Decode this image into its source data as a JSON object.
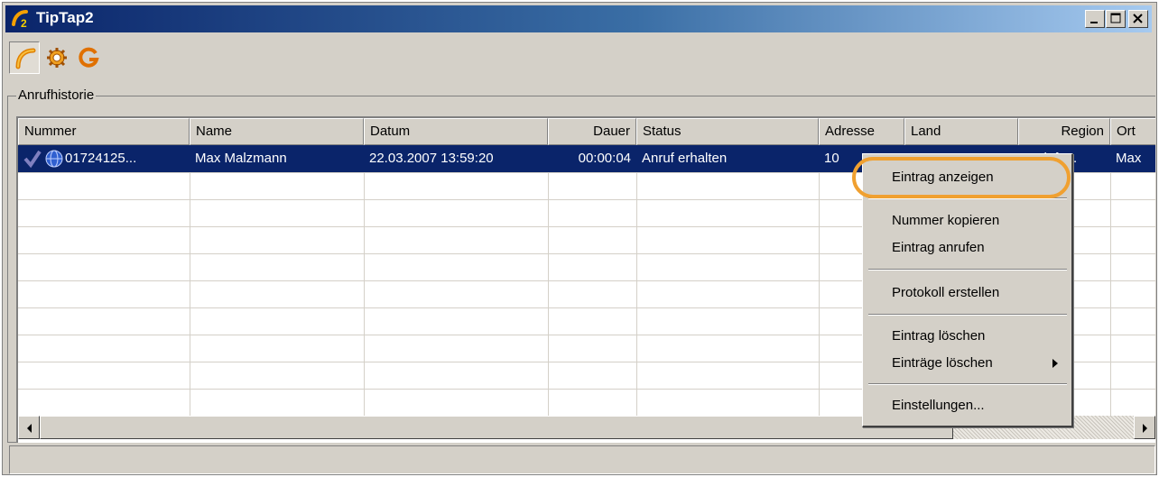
{
  "window": {
    "title": "TipTap2",
    "controls": [
      "minimize",
      "maximize",
      "close"
    ]
  },
  "toolbar": {
    "buttons": [
      {
        "name": "phone-tab",
        "icon": "phone-handset-icon",
        "active": true
      },
      {
        "name": "settings-tab",
        "icon": "gear-icon",
        "active": false
      },
      {
        "name": "app-tab",
        "icon": "g-logo-icon",
        "active": false
      }
    ]
  },
  "group": {
    "label": "Anrufhistorie"
  },
  "columns": [
    "Nummer",
    "Name",
    "Datum",
    "Dauer",
    "Status",
    "Adresse",
    "Land",
    "Region",
    "Ort"
  ],
  "rows": [
    {
      "nummer": "01724125...",
      "name": "Max Malzmann",
      "datum": "22.03.2007 13:59:20",
      "dauer": "00:00:04",
      "status": "Anruf erhalten",
      "adresse": "10",
      "land": "",
      "region": "Vodafo...",
      "ort": "Max",
      "icons": [
        "checkmark-icon",
        "globe-icon"
      ],
      "selected": true
    }
  ],
  "context_menu": {
    "items": [
      {
        "label": "Eintrag anzeigen",
        "highlighted": true
      },
      {
        "separator": true
      },
      {
        "label": "Nummer kopieren"
      },
      {
        "label": "Eintrag anrufen"
      },
      {
        "separator": true
      },
      {
        "label": "Protokoll erstellen"
      },
      {
        "separator": true
      },
      {
        "label": "Eintrag löschen"
      },
      {
        "label": "Einträge löschen",
        "submenu": true
      },
      {
        "separator": true
      },
      {
        "label": "Einstellungen..."
      }
    ]
  },
  "colors": {
    "titlebar_start": "#0a246a",
    "titlebar_end": "#a6caf0",
    "selection": "#0a246a",
    "face": "#d4d0c8",
    "highlight_ring": "#f0a030"
  }
}
